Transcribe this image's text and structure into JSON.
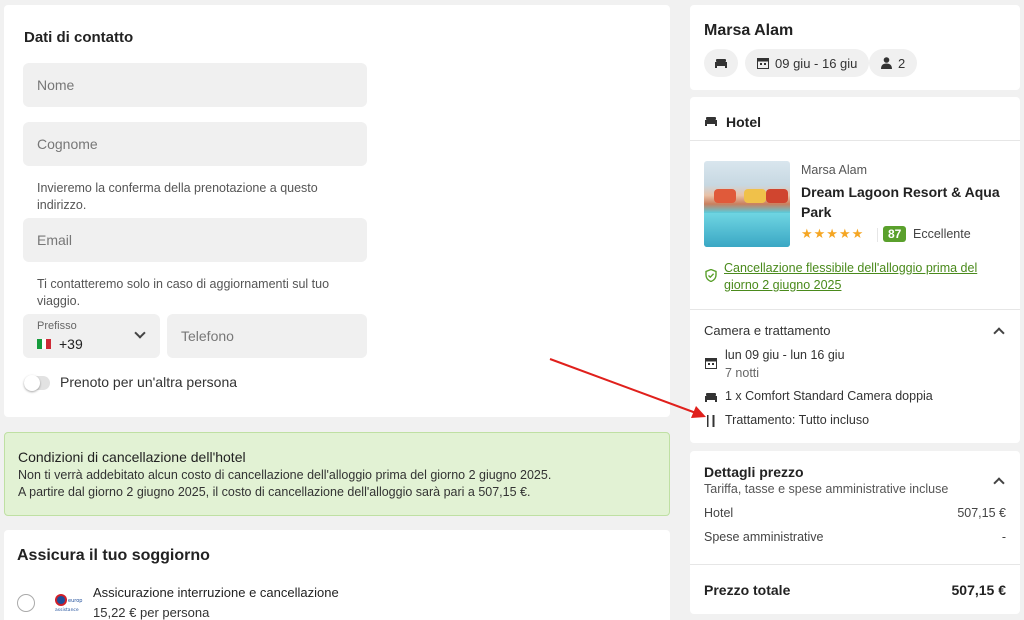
{
  "contact": {
    "title": "Dati di contatto",
    "first_name_placeholder": "Nome",
    "last_name_placeholder": "Cognome",
    "email_hint": "Invieremo la conferma della prenotazione a questo indirizzo.",
    "email_placeholder": "Email",
    "phone_hint": "Ti contatteremo solo in caso di aggiornamenti sul tuo viaggio.",
    "prefix_label": "Prefisso",
    "prefix_value": "+39",
    "phone_placeholder": "Telefono",
    "other_person_label": "Prenoto per un'altra persona"
  },
  "cancellation_banner": {
    "title": "Condizioni di cancellazione dell'hotel",
    "line1": "Non ti verrà addebitato alcun costo di cancellazione dell'alloggio prima del giorno 2 giugno 2025.",
    "line2": "A partire dal giorno 2 giugno 2025, il costo di cancellazione dell'alloggio sarà pari a 507,15 €."
  },
  "insurance": {
    "title": "Assicura il tuo soggiorno",
    "option_title": "Assicurazione interruzione e cancellazione",
    "option_price": "15,22 € per persona",
    "provider_logo_text": "europ assistance"
  },
  "summary": {
    "destination": "Marsa Alam",
    "dates": "09 giu - 16 giu",
    "guests": "2"
  },
  "hotel": {
    "section_title": "Hotel",
    "location": "Marsa Alam",
    "name_line1": "Dream Lagoon Resort & Aqua",
    "name_line2": "Park",
    "stars": "★★★★★",
    "score": "87",
    "rating_label": "Eccellente",
    "flex_cancel_line1": "Cancellazione flessibile dell'alloggio prima del",
    "flex_cancel_line2": "giorno 2 giugno 2025",
    "room_section_title": "Camera e trattamento",
    "stay_dates": "lun 09 giu - lun 16 giu",
    "nights": "7 notti",
    "room": "1 x Comfort Standard Camera doppia",
    "board": "Trattamento: Tutto incluso"
  },
  "price": {
    "title": "Dettagli prezzo",
    "subtitle": "Tariffa, tasse e spese amministrative incluse",
    "rows": [
      {
        "label": "Hotel",
        "value": "507,15 €"
      },
      {
        "label": "Spese amministrative",
        "value": "-"
      }
    ],
    "total_label": "Prezzo totale",
    "total_value": "507,15 €"
  },
  "colors": {
    "accent_green": "#5aa02c",
    "banner_bg": "#e2f2d4",
    "annotation_arrow": "#e0201c"
  }
}
